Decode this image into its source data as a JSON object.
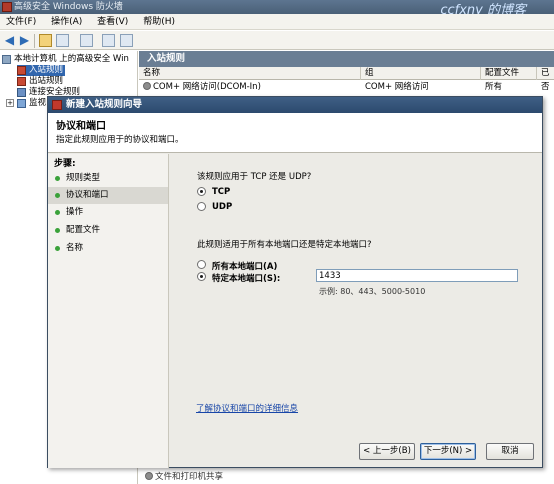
{
  "window": {
    "title": "高级安全 Windows 防火墙",
    "watermark": "ccfxny 的博客"
  },
  "menu": [
    "文件(F)",
    "操作(A)",
    "查看(V)",
    "帮助(H)"
  ],
  "tree": {
    "root": "本地计算机 上的高级安全 Win",
    "items": [
      "入站规则",
      "出站规则",
      "连接安全规则",
      "监视"
    ]
  },
  "list": {
    "header": "入站规则",
    "columns": [
      "名称",
      "组",
      "配置文件",
      "已"
    ],
    "row": {
      "name": "COM+ 网络访问(DCOM-In)",
      "group": "COM+ 网络访问",
      "profile": "所有",
      "enabled": "否"
    },
    "partial_row": "文件和打印机共享"
  },
  "dialog": {
    "title": "新建入站规则向导",
    "heading": "协议和端口",
    "subheading": "指定此规则应用于的协议和端口。",
    "steps_title": "步骤:",
    "steps": [
      "规则类型",
      "协议和端口",
      "操作",
      "配置文件",
      "名称"
    ],
    "active_step": 1,
    "protocol_question": "该规则应用于 TCP 还是 UDP?",
    "protocols": [
      "TCP",
      "UDP"
    ],
    "selected_protocol": "TCP",
    "port_question": "此规则适用于所有本地端口还是特定本地端口?",
    "port_options": [
      "所有本地端口(A)",
      "特定本地端口(S):"
    ],
    "selected_port_option": "特定本地端口(S):",
    "port_value": "1433",
    "port_example": "示例: 80、443、5000-5010",
    "help_link": "了解协议和端口的详细信息",
    "buttons": {
      "back": "< 上一步(B)",
      "next": "下一步(N) >",
      "cancel": "取消"
    }
  },
  "colors": {
    "title_bar": "#4a6077",
    "selection": "#3166ae",
    "link": "#1846a8",
    "step_bullet": "#3aa23a"
  }
}
